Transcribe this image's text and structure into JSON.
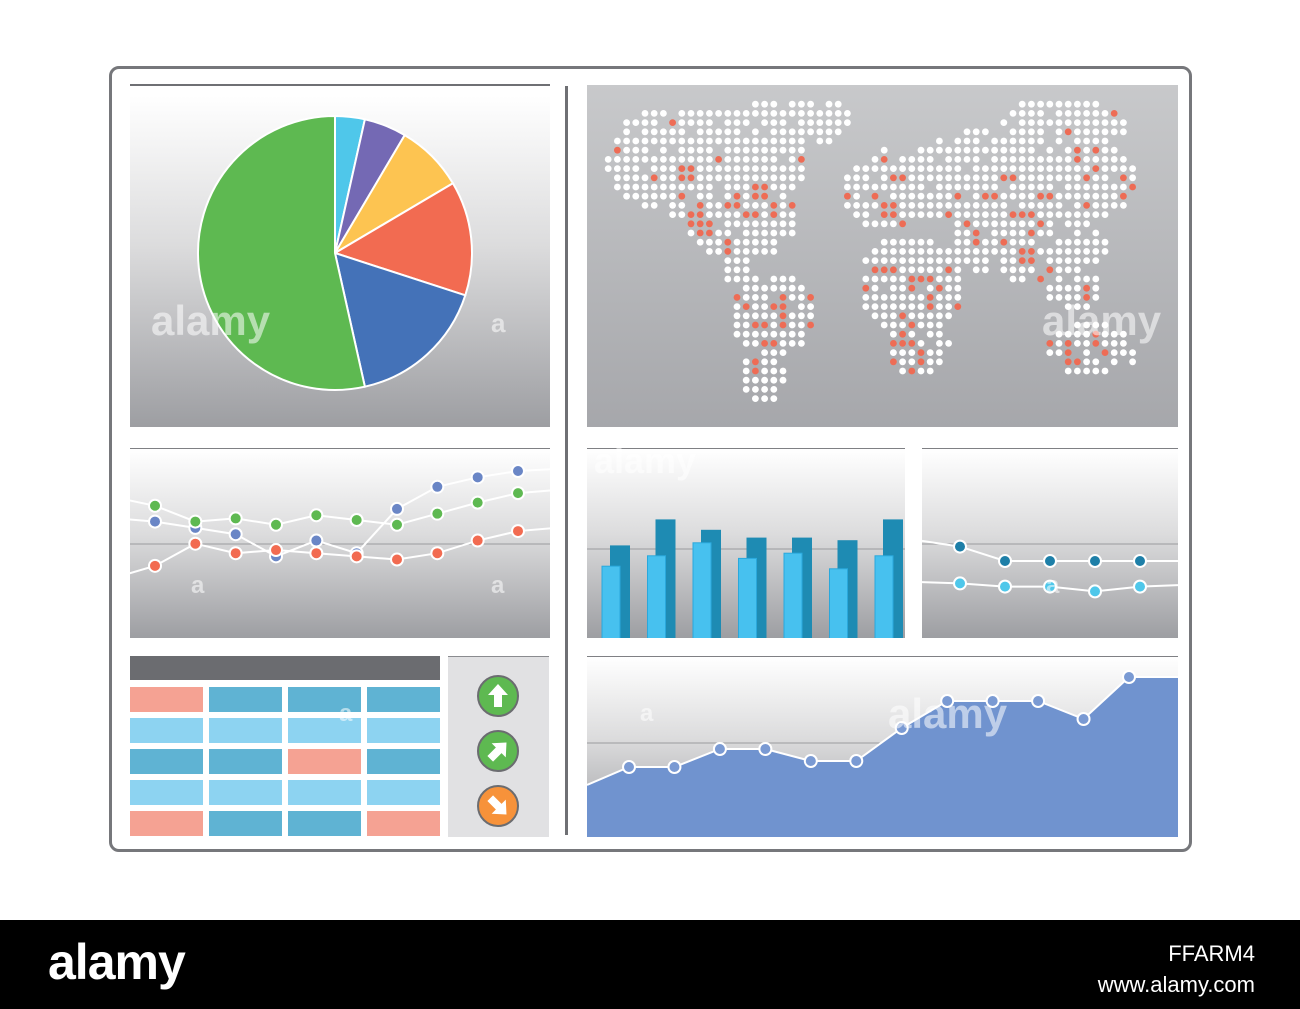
{
  "dashboard": {
    "colors": {
      "frame": "#76777b",
      "green": "#5eb951",
      "cyan": "#4fc7ea",
      "purple": "#7469b4",
      "yellow": "#fdc451",
      "orange": "#f26b51",
      "blue": "#4472b8",
      "area_fill": "#7093cf",
      "dark_bar": "#1e8bb3",
      "light_bar": "#47c1ef",
      "table_salmon": "#f5a293",
      "table_teal": "#5fb3d3",
      "table_light": "#8dd3f1",
      "map_dot_white": "#ffffff",
      "map_dot_red": "#ee6c55"
    },
    "pie_panel": {
      "chart_type": "pie",
      "slices": [
        {
          "value": 3.5,
          "color": "#4fc7ea"
        },
        {
          "value": 5.0,
          "color": "#7469b4"
        },
        {
          "value": 8.0,
          "color": "#fdc451"
        },
        {
          "value": 13.5,
          "color": "#f26b51"
        },
        {
          "value": 16.5,
          "color": "#4472b8"
        },
        {
          "value": 53.5,
          "color": "#5eb951"
        }
      ]
    },
    "multi_line_panel": {
      "chart_type": "line",
      "series": [
        {
          "color": "#6a86c6",
          "values": [
            50,
            46,
            42,
            28,
            38,
            30,
            58,
            72,
            78,
            82
          ]
        },
        {
          "color": "#5eb951",
          "values": [
            60,
            50,
            52,
            48,
            54,
            51,
            48,
            55,
            62,
            68
          ]
        },
        {
          "color": "#f26b51",
          "values": [
            22,
            36,
            30,
            32,
            30,
            28,
            26,
            30,
            38,
            44
          ]
        }
      ]
    },
    "bar_panel": {
      "chart_type": "bar",
      "series": [
        {
          "color": "#47c1ef",
          "values": [
            28,
            32,
            37,
            31,
            33,
            27,
            32
          ]
        },
        {
          "color": "#1e8bb3",
          "values": [
            36,
            46,
            42,
            39,
            39,
            38,
            46
          ]
        }
      ]
    },
    "small_line_panel": {
      "chart_type": "line",
      "series": [
        {
          "color": "#1e7fa8",
          "values": [
            78,
            60,
            60,
            60,
            60
          ]
        },
        {
          "color": "#4fc7ea",
          "values": [
            32,
            28,
            28,
            22,
            28
          ]
        }
      ]
    },
    "area_panel": {
      "chart_type": "area",
      "values": [
        20,
        20,
        26,
        26,
        22,
        22,
        33,
        42,
        42,
        42,
        36,
        50
      ]
    },
    "table": {
      "rows": [
        [
          "salmon",
          "teal",
          "teal",
          "teal"
        ],
        [
          "light",
          "light",
          "light",
          "light"
        ],
        [
          "teal",
          "teal",
          "salmon",
          "teal"
        ],
        [
          "light",
          "light",
          "light",
          "light"
        ],
        [
          "salmon",
          "teal",
          "teal",
          "salmon"
        ]
      ]
    },
    "arrow_buttons": [
      {
        "icon": "arrow-up-icon",
        "color": "#5eb951"
      },
      {
        "icon": "arrow-up-right-icon",
        "color": "#5eb951"
      },
      {
        "icon": "arrow-down-right-icon",
        "color": "#f7923a"
      }
    ]
  },
  "watermark": {
    "brand": "alamy",
    "letter": "a",
    "image_id": "FFARM4",
    "url": "www.alamy.com"
  }
}
